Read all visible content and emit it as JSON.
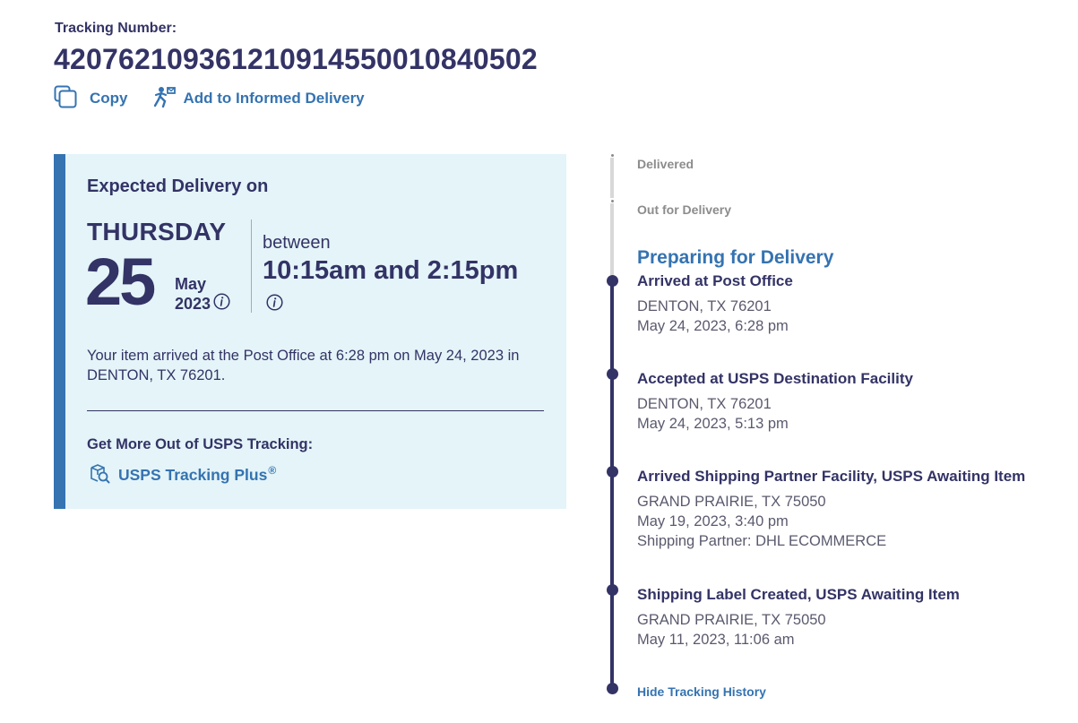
{
  "header": {
    "tracking_label": "Tracking Number:",
    "tracking_number": "420762109361210914550010840502",
    "copy_label": "Copy",
    "informed_label": "Add to Informed Delivery"
  },
  "delivery": {
    "title": "Expected Delivery on",
    "weekday": "THURSDAY",
    "day": "25",
    "month": "May",
    "year": "2023",
    "between": "between",
    "window": "10:15am and 2:15pm",
    "arrived_text": "Your item arrived at the Post Office at 6:28 pm on May 24, 2023 in DENTON, TX 76201.",
    "more_title": "Get More Out of USPS Tracking:",
    "plus_label": "USPS Tracking Plus",
    "plus_mark": "®"
  },
  "timeline": {
    "future_statuses": [
      "Delivered",
      "Out for Delivery"
    ],
    "current_status": "Preparing for Delivery",
    "events": [
      {
        "title": "Arrived at Post Office",
        "location": "DENTON, TX 76201",
        "time": "May 24, 2023, 6:28 pm"
      },
      {
        "title": "Accepted at USPS Destination Facility",
        "location": "DENTON, TX 76201",
        "time": "May 24, 2023, 5:13 pm"
      },
      {
        "title": "Arrived Shipping Partner Facility, USPS Awaiting Item",
        "location": "GRAND PRAIRIE, TX 75050",
        "time": "May 19, 2023, 3:40 pm",
        "note": "Shipping Partner: DHL ECOMMERCE"
      },
      {
        "title": "Shipping Label Created, USPS Awaiting Item",
        "location": "GRAND PRAIRIE, TX 75050",
        "time": "May 11, 2023, 11:06 am"
      }
    ],
    "hide_label": "Hide Tracking History"
  },
  "colors": {
    "navy": "#333366",
    "link_blue": "#3573b1",
    "card_bg": "#e4f4f8",
    "grey": "#8c8c8c"
  }
}
